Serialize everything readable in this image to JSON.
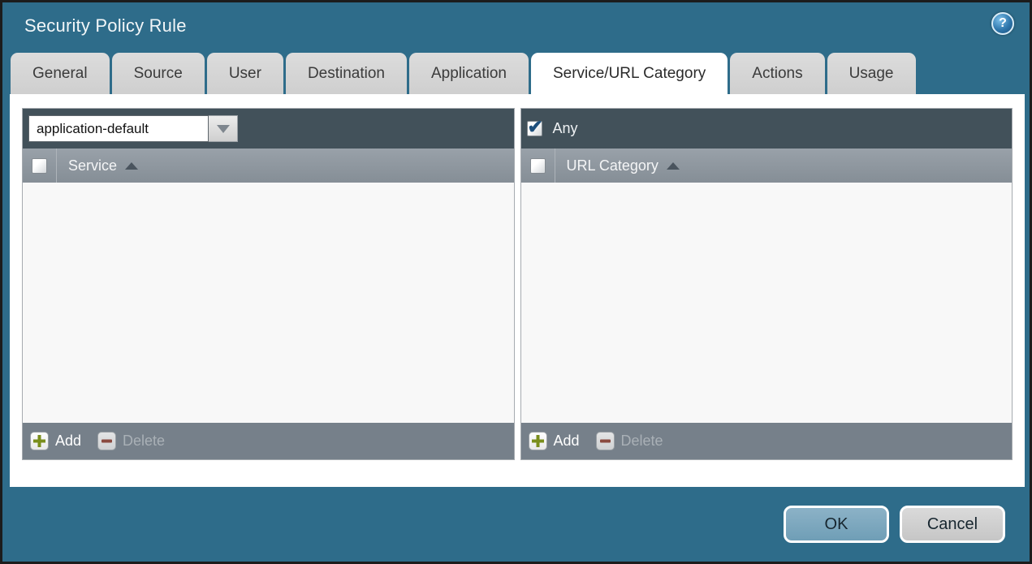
{
  "window": {
    "title": "Security Policy Rule",
    "help_glyph": "?"
  },
  "tabs": {
    "active": "Service/URL Category",
    "items": [
      {
        "label": "General"
      },
      {
        "label": "Source"
      },
      {
        "label": "User"
      },
      {
        "label": "Destination"
      },
      {
        "label": "Application"
      },
      {
        "label": "Service/URL Category"
      },
      {
        "label": "Actions"
      },
      {
        "label": "Usage"
      }
    ]
  },
  "service_panel": {
    "select_value": "application-default",
    "column_header": "Service",
    "sort_order": "ascending",
    "header_checkbox_checked": false,
    "rows": [],
    "add_label": "Add",
    "delete_label": "Delete",
    "delete_enabled": false
  },
  "url_category_panel": {
    "any_label": "Any",
    "any_checked": true,
    "column_header": "URL Category",
    "sort_order": "ascending",
    "header_checkbox_checked": false,
    "rows": [],
    "add_label": "Add",
    "delete_label": "Delete",
    "delete_enabled": false
  },
  "dialog_actions": {
    "ok_label": "OK",
    "cancel_label": "Cancel"
  },
  "colors": {
    "titlebar_bg": "#2e6c8a",
    "window_border": "#1c1c1c",
    "tab_bg": "#d3d3d3",
    "active_tab_bg": "#ffffff",
    "panel_header_bg": "#42515a",
    "column_header_bg": "#8b949c",
    "panel_body_bg": "#f8f8f8",
    "panel_footer_bg": "#76808a",
    "ok_button_bg": "#7da9c0",
    "cancel_button_bg": "#d2d2d2",
    "add_icon_green": "#7a8e1c",
    "delete_icon_red": "#8a4a40",
    "checkmark_blue": "#1d4f7c"
  }
}
